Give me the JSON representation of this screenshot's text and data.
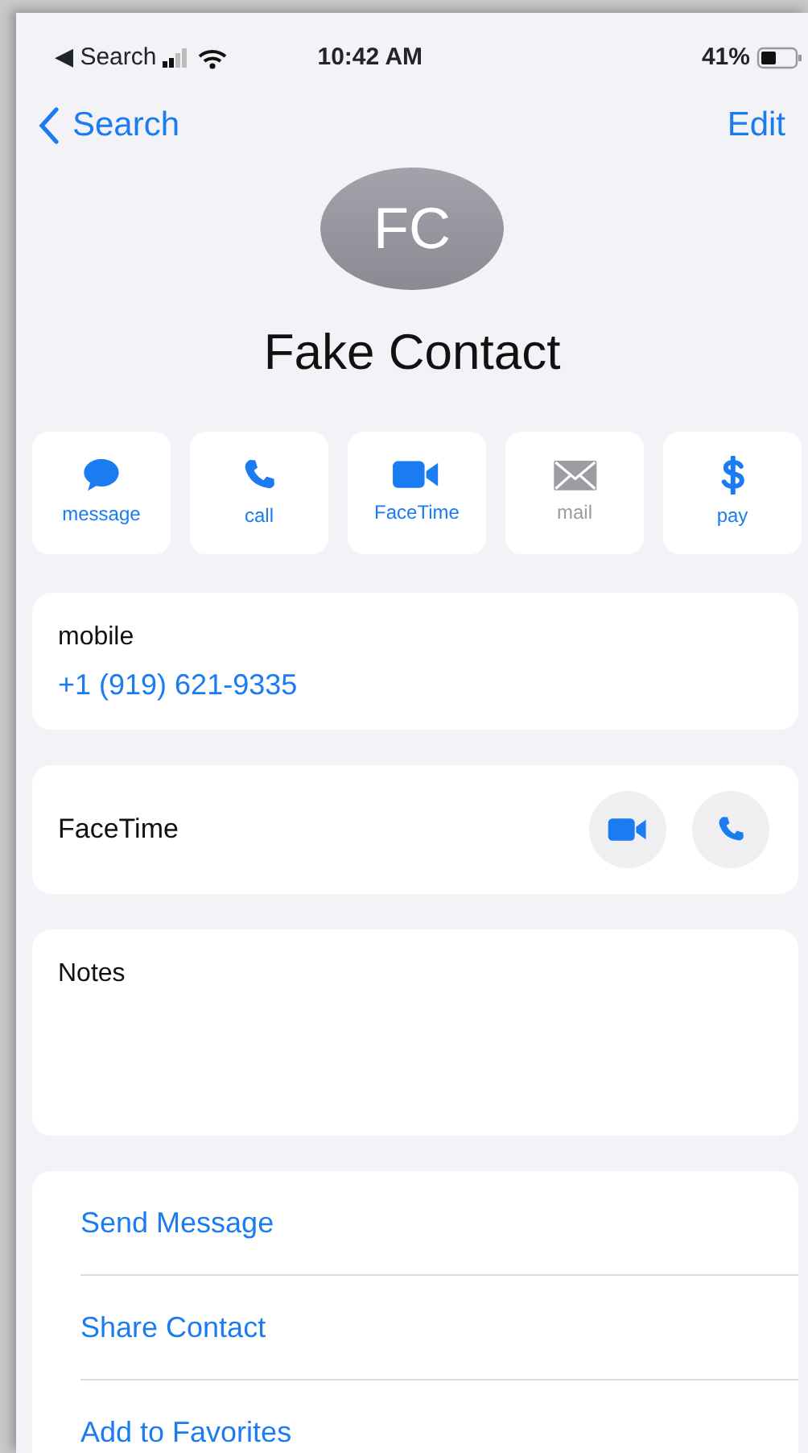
{
  "status_bar": {
    "back_app": "◀ Search",
    "time": "10:42 AM",
    "battery": "41%"
  },
  "nav": {
    "back": "Search",
    "edit": "Edit"
  },
  "contact": {
    "initials": "FC",
    "name": "Fake Contact"
  },
  "actions": [
    {
      "kind": "message",
      "label": "message",
      "disabled": false
    },
    {
      "kind": "call",
      "label": "call",
      "disabled": false
    },
    {
      "kind": "video",
      "label": "FaceTime",
      "disabled": false
    },
    {
      "kind": "mail",
      "label": "mail",
      "disabled": true
    },
    {
      "kind": "pay",
      "label": "pay",
      "disabled": false
    }
  ],
  "phone": {
    "label": "mobile",
    "value": "+1 (919) 621-9335"
  },
  "facetime": {
    "label": "FaceTime",
    "buttons": [
      {
        "kind": "video"
      },
      {
        "kind": "call"
      }
    ]
  },
  "notes": {
    "label": "Notes"
  },
  "links": [
    "Send Message",
    "Share Contact",
    "Add to Favorites"
  ]
}
